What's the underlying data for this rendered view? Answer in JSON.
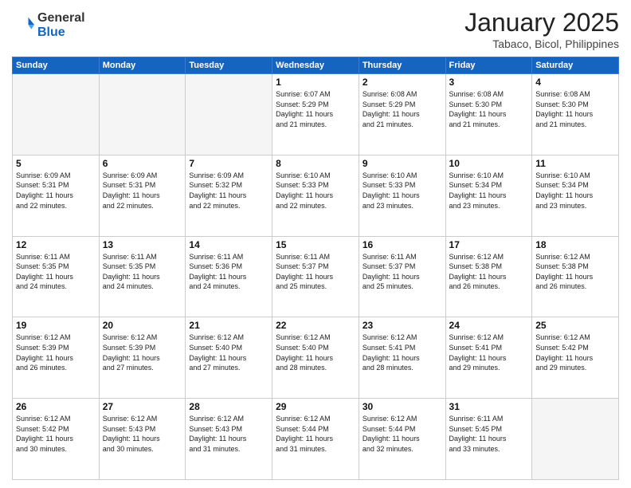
{
  "header": {
    "logo": {
      "line1": "General",
      "line2": "Blue"
    },
    "title": "January 2025",
    "location": "Tabaco, Bicol, Philippines"
  },
  "weekdays": [
    "Sunday",
    "Monday",
    "Tuesday",
    "Wednesday",
    "Thursday",
    "Friday",
    "Saturday"
  ],
  "weeks": [
    [
      {
        "day": "",
        "info": ""
      },
      {
        "day": "",
        "info": ""
      },
      {
        "day": "",
        "info": ""
      },
      {
        "day": "1",
        "info": "Sunrise: 6:07 AM\nSunset: 5:29 PM\nDaylight: 11 hours\nand 21 minutes."
      },
      {
        "day": "2",
        "info": "Sunrise: 6:08 AM\nSunset: 5:29 PM\nDaylight: 11 hours\nand 21 minutes."
      },
      {
        "day": "3",
        "info": "Sunrise: 6:08 AM\nSunset: 5:30 PM\nDaylight: 11 hours\nand 21 minutes."
      },
      {
        "day": "4",
        "info": "Sunrise: 6:08 AM\nSunset: 5:30 PM\nDaylight: 11 hours\nand 21 minutes."
      }
    ],
    [
      {
        "day": "5",
        "info": "Sunrise: 6:09 AM\nSunset: 5:31 PM\nDaylight: 11 hours\nand 22 minutes."
      },
      {
        "day": "6",
        "info": "Sunrise: 6:09 AM\nSunset: 5:31 PM\nDaylight: 11 hours\nand 22 minutes."
      },
      {
        "day": "7",
        "info": "Sunrise: 6:09 AM\nSunset: 5:32 PM\nDaylight: 11 hours\nand 22 minutes."
      },
      {
        "day": "8",
        "info": "Sunrise: 6:10 AM\nSunset: 5:33 PM\nDaylight: 11 hours\nand 22 minutes."
      },
      {
        "day": "9",
        "info": "Sunrise: 6:10 AM\nSunset: 5:33 PM\nDaylight: 11 hours\nand 23 minutes."
      },
      {
        "day": "10",
        "info": "Sunrise: 6:10 AM\nSunset: 5:34 PM\nDaylight: 11 hours\nand 23 minutes."
      },
      {
        "day": "11",
        "info": "Sunrise: 6:10 AM\nSunset: 5:34 PM\nDaylight: 11 hours\nand 23 minutes."
      }
    ],
    [
      {
        "day": "12",
        "info": "Sunrise: 6:11 AM\nSunset: 5:35 PM\nDaylight: 11 hours\nand 24 minutes."
      },
      {
        "day": "13",
        "info": "Sunrise: 6:11 AM\nSunset: 5:35 PM\nDaylight: 11 hours\nand 24 minutes."
      },
      {
        "day": "14",
        "info": "Sunrise: 6:11 AM\nSunset: 5:36 PM\nDaylight: 11 hours\nand 24 minutes."
      },
      {
        "day": "15",
        "info": "Sunrise: 6:11 AM\nSunset: 5:37 PM\nDaylight: 11 hours\nand 25 minutes."
      },
      {
        "day": "16",
        "info": "Sunrise: 6:11 AM\nSunset: 5:37 PM\nDaylight: 11 hours\nand 25 minutes."
      },
      {
        "day": "17",
        "info": "Sunrise: 6:12 AM\nSunset: 5:38 PM\nDaylight: 11 hours\nand 26 minutes."
      },
      {
        "day": "18",
        "info": "Sunrise: 6:12 AM\nSunset: 5:38 PM\nDaylight: 11 hours\nand 26 minutes."
      }
    ],
    [
      {
        "day": "19",
        "info": "Sunrise: 6:12 AM\nSunset: 5:39 PM\nDaylight: 11 hours\nand 26 minutes."
      },
      {
        "day": "20",
        "info": "Sunrise: 6:12 AM\nSunset: 5:39 PM\nDaylight: 11 hours\nand 27 minutes."
      },
      {
        "day": "21",
        "info": "Sunrise: 6:12 AM\nSunset: 5:40 PM\nDaylight: 11 hours\nand 27 minutes."
      },
      {
        "day": "22",
        "info": "Sunrise: 6:12 AM\nSunset: 5:40 PM\nDaylight: 11 hours\nand 28 minutes."
      },
      {
        "day": "23",
        "info": "Sunrise: 6:12 AM\nSunset: 5:41 PM\nDaylight: 11 hours\nand 28 minutes."
      },
      {
        "day": "24",
        "info": "Sunrise: 6:12 AM\nSunset: 5:41 PM\nDaylight: 11 hours\nand 29 minutes."
      },
      {
        "day": "25",
        "info": "Sunrise: 6:12 AM\nSunset: 5:42 PM\nDaylight: 11 hours\nand 29 minutes."
      }
    ],
    [
      {
        "day": "26",
        "info": "Sunrise: 6:12 AM\nSunset: 5:42 PM\nDaylight: 11 hours\nand 30 minutes."
      },
      {
        "day": "27",
        "info": "Sunrise: 6:12 AM\nSunset: 5:43 PM\nDaylight: 11 hours\nand 30 minutes."
      },
      {
        "day": "28",
        "info": "Sunrise: 6:12 AM\nSunset: 5:43 PM\nDaylight: 11 hours\nand 31 minutes."
      },
      {
        "day": "29",
        "info": "Sunrise: 6:12 AM\nSunset: 5:44 PM\nDaylight: 11 hours\nand 31 minutes."
      },
      {
        "day": "30",
        "info": "Sunrise: 6:12 AM\nSunset: 5:44 PM\nDaylight: 11 hours\nand 32 minutes."
      },
      {
        "day": "31",
        "info": "Sunrise: 6:11 AM\nSunset: 5:45 PM\nDaylight: 11 hours\nand 33 minutes."
      },
      {
        "day": "",
        "info": ""
      }
    ]
  ]
}
